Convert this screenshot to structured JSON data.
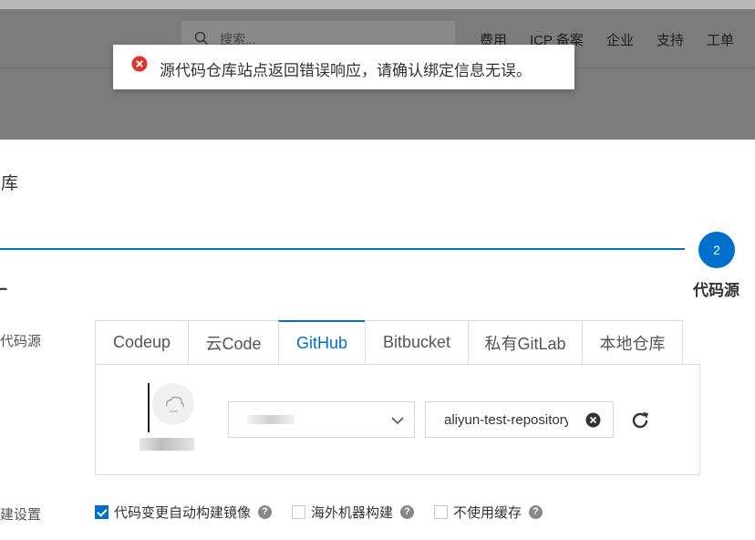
{
  "header": {
    "search_placeholder": "搜索...",
    "nav": [
      "费用",
      "ICP 备案",
      "企业",
      "支持",
      "工单"
    ]
  },
  "toast": {
    "message": "源代码仓库站点返回错误响应，请确认绑定信息无误。",
    "type": "error",
    "icon": "error-circle-icon",
    "icon_color": "#e5322d"
  },
  "drawer": {
    "title_fragment": "仓库",
    "steps": [
      {
        "label_fragment": "一"
      },
      {
        "number": "2",
        "label": "代码源",
        "active": true
      }
    ],
    "accent_color": "#0070cc"
  },
  "form": {
    "source_label_fragment": "代码源",
    "build_label_fragment": "建设置",
    "tabs": [
      {
        "label": "Codeup",
        "active": false
      },
      {
        "label": "云Code",
        "active": false
      },
      {
        "label": "GitHub",
        "active": true
      },
      {
        "label": "Bitbucket",
        "active": false
      },
      {
        "label": "私有GitLab",
        "active": false
      },
      {
        "label": "本地仓库",
        "active": false
      }
    ],
    "namespace_select": {
      "value": "",
      "icon": "chevron-down-icon"
    },
    "repository_input": {
      "value": "aliyun-test-repository",
      "clear_icon": "clear-icon"
    },
    "refresh_icon": "refresh-icon",
    "build_options": [
      {
        "label": "代码变更自动构建镜像",
        "checked": true
      },
      {
        "label": "海外机器构建",
        "checked": false
      },
      {
        "label": "不使用缓存",
        "checked": false
      }
    ],
    "help_glyph": "?"
  }
}
